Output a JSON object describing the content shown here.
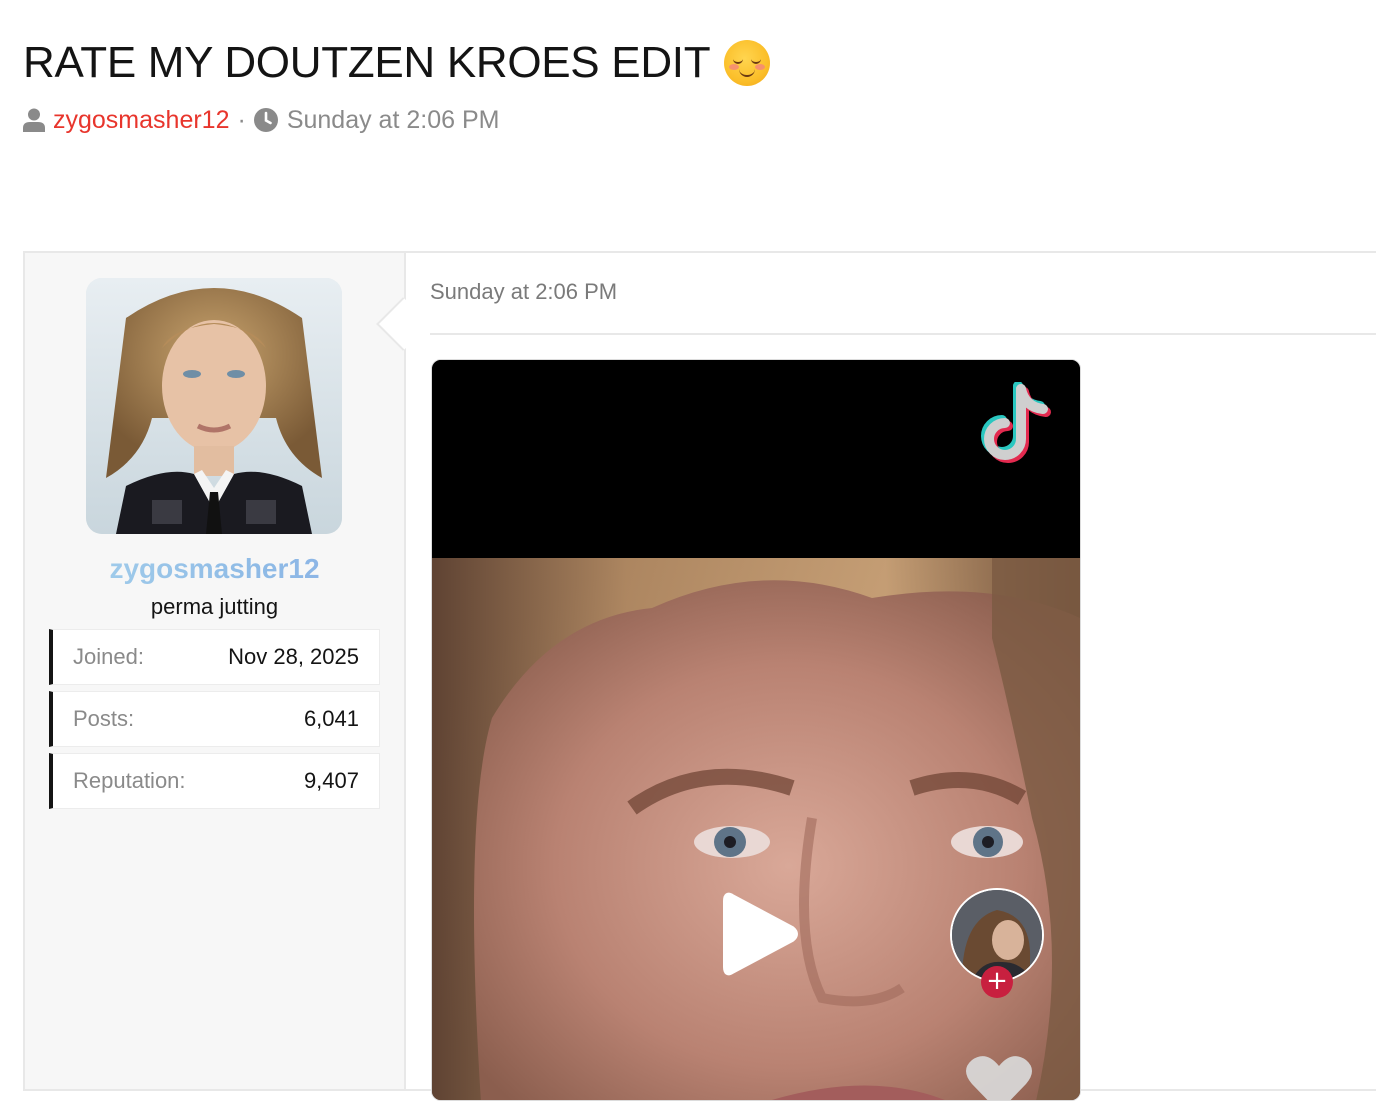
{
  "thread": {
    "title": "RATE MY DOUTZEN KROES EDIT",
    "title_emoji": "smiling-face-with-blush",
    "author": "zygosmasher12",
    "separator": "·",
    "timestamp": "Sunday at 2:06 PM"
  },
  "sidebar": {
    "username": "zygosmasher12",
    "user_title": "perma jutting",
    "stats": [
      {
        "label": "Joined:",
        "value": "Nov 28, 2025"
      },
      {
        "label": "Posts:",
        "value": "6,041"
      },
      {
        "label": "Reputation:",
        "value": "9,407"
      }
    ]
  },
  "post": {
    "date": "Sunday at 2:06 PM",
    "embed": {
      "platform_icon": "tiktok-icon",
      "follow_label": "+"
    }
  },
  "colors": {
    "username_link": "#e8352c",
    "meta_gray": "#8a8a8a",
    "sidebar_bg": "#f7f7f7",
    "follow_badge": "#c8203f"
  }
}
